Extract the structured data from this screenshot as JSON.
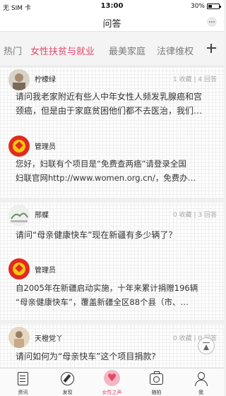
{
  "status_bar": {
    "carrier": "无 SIM 卡 ",
    "time": "13:00",
    "battery": "30%"
  },
  "nav": {
    "title": "问答",
    "more_icon": "ellipsis-icon"
  },
  "tabs": {
    "items": [
      {
        "label": "热门",
        "active": false
      },
      {
        "label": "女性扶贫与就业",
        "active": true
      },
      {
        "label": "最美家庭",
        "active": false
      },
      {
        "label": "法律维权",
        "active": false
      }
    ],
    "add_icon": "plus-icon",
    "accent_color": "#e8446a"
  },
  "threads": [
    {
      "asker": "柠檬绿",
      "favorites": "1 收藏",
      "answers_count": "4 回答",
      "question_lines": [
        "请问我老家附近有些人中年女性人频发乳腺癌和宫",
        "颈癌，但是由于家庭贫困他们都不去医治，我们…"
      ],
      "answerer": "管理员",
      "answer_lines": [
        "您好，妇联有个项目是“免费查两癌”请登录全国",
        "妇联官网http://www.women.org.cn/，免费办…"
      ]
    },
    {
      "asker": "邢蝶",
      "favorites": "0 收藏",
      "answers_count": "3 回答",
      "question_lines": [
        "请问“母亲健康快车”现在新疆有多少辆了？"
      ],
      "answerer": "管理员",
      "answer_lines": [
        "自2005年在新疆启动实施，十年来累计捐赠196辆",
        "“母亲健康快车”，覆盖新疆全区88个县（市、…"
      ]
    },
    {
      "asker": "天橙党丫",
      "favorites": "0 收藏",
      "answers_count": "0 回答",
      "question_lines": [
        "请问如何为“母亲快车”这个项目捐款?"
      ]
    }
  ],
  "tabbar": {
    "items": [
      {
        "label": "资讯",
        "icon": "document-icon",
        "active": false
      },
      {
        "label": "发现",
        "icon": "compass-icon",
        "active": false
      },
      {
        "label": "女性之声",
        "icon": "heart-icon",
        "active": true
      },
      {
        "label": "随拍",
        "icon": "camera-icon",
        "active": false
      },
      {
        "label": "我",
        "icon": "person-icon",
        "active": false
      }
    ]
  }
}
